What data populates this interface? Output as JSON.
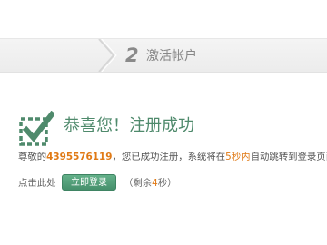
{
  "step": {
    "number": "2",
    "label": "激活帐户"
  },
  "success": {
    "title": "恭喜您！注册成功"
  },
  "message": {
    "prefix": "尊敬的",
    "account": "4395576119",
    "middle": "，您已成功注册，系统将在",
    "seconds_text": "5秒内",
    "suffix": "自动跳转到登录页面。"
  },
  "action": {
    "click_here": "点击此处",
    "login_button": "立即登录",
    "countdown_prefix": "（剩余",
    "countdown_value": "4",
    "countdown_suffix": "秒）"
  },
  "colors": {
    "accent_green": "#4f8a6c",
    "highlight_orange": "#e07a16"
  },
  "icons": {
    "check": "checkmark-box-icon"
  }
}
